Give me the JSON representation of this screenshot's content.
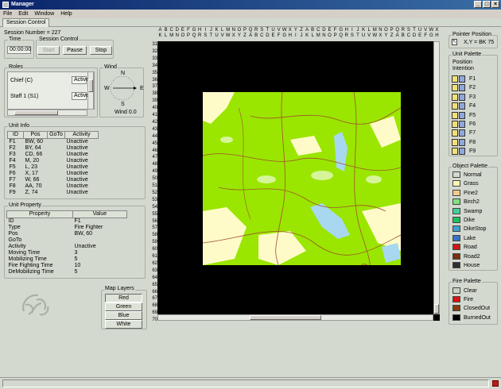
{
  "window": {
    "title": "Manager"
  },
  "menu": [
    "File",
    "Edit",
    "Window",
    "Help"
  ],
  "tabs": [
    {
      "label": "Session Control"
    }
  ],
  "session": {
    "number_label": "Session Number = 227"
  },
  "time": {
    "title": "Time",
    "value": "00:00:00"
  },
  "session_control": {
    "title": "Session Control",
    "buttons": [
      "Start",
      "Pause",
      "Stop"
    ]
  },
  "roles": {
    "title": "Roles",
    "items": [
      {
        "name": "Chief  (C)",
        "status": "Active"
      },
      {
        "name": "Staff 1  (S1)",
        "status": "Active"
      }
    ]
  },
  "wind": {
    "title": "Wind",
    "N": "N",
    "S": "S",
    "E": "E",
    "W": "W",
    "value": "Wind 0.0"
  },
  "unit_info": {
    "title": "Unit Info",
    "columns": [
      "ID",
      "Pos",
      "GoTo",
      "Activity"
    ],
    "rows": [
      [
        "F1",
        "BW, 60",
        "",
        "Unactive"
      ],
      [
        "F2",
        "BY, 64",
        "",
        "Unactive"
      ],
      [
        "F3",
        "CD, 66",
        "",
        "Unactive"
      ],
      [
        "F4",
        "M, 20",
        "",
        "Unactive"
      ],
      [
        "F5",
        "L, 23",
        "",
        "Unactive"
      ],
      [
        "F6",
        "X, 17",
        "",
        "Unactive"
      ],
      [
        "F7",
        "W, 66",
        "",
        "Unactive"
      ],
      [
        "F8",
        "AA, 70",
        "",
        "Unactive"
      ],
      [
        "F9",
        "Z, 74",
        "",
        "Unactive"
      ]
    ]
  },
  "unit_property": {
    "title": "Unit Property",
    "columns": [
      "Property",
      "Value"
    ],
    "rows": [
      [
        "ID",
        "F1"
      ],
      [
        "Type",
        "Fire Fighter"
      ],
      [
        "Pos",
        "BW, 60"
      ],
      [
        "GoTo",
        ""
      ],
      [
        "Activity",
        "Unactive"
      ],
      [
        "Moving Time",
        "3"
      ],
      [
        "Mobilizing Time",
        "5"
      ],
      [
        "Fire Fighting Time",
        "10"
      ],
      [
        "DeMobilizing Time",
        "5"
      ]
    ]
  },
  "map_layers": {
    "title": "Map Layers",
    "buttons": [
      "Red",
      "Green",
      "Blue",
      "White"
    ]
  },
  "grid": {
    "columns": [
      "A K",
      "B L",
      "C M",
      "D N",
      "E O",
      "F P",
      "G Q",
      "H R",
      "I S",
      "J T",
      "K U",
      "L V",
      "M W",
      "N X",
      "O Y",
      "P Z",
      "Q A",
      "R B",
      "S C",
      "T D",
      "U E",
      "V F",
      "W G",
      "X H",
      "Y I",
      "Z J",
      "A K",
      "B L",
      "C M",
      "D N",
      "E O",
      "F P",
      "G Q",
      "H R",
      "I S",
      "J T",
      "K U",
      "L V",
      "M W",
      "N X",
      "O Y",
      "P Z",
      "Q A",
      "R B",
      "S C",
      "T D",
      "U E",
      "V F",
      "W G",
      "X H"
    ],
    "rows": [
      "31",
      "32",
      "33",
      "34",
      "35",
      "36",
      "37",
      "38",
      "39",
      "40",
      "41",
      "42",
      "43",
      "44",
      "45",
      "46",
      "47",
      "48",
      "49",
      "50",
      "51",
      "52",
      "53",
      "54",
      "55",
      "56",
      "57",
      "58",
      "59",
      "60",
      "61",
      "62",
      "63",
      "64",
      "65",
      "66",
      "67",
      "68",
      "69",
      "70"
    ]
  },
  "pointer_position": {
    "title": "Pointer Position",
    "value": "X,Y = BK 75"
  },
  "unit_palette": {
    "title": "Unit Palette",
    "header": "Position\nIntention",
    "items": [
      "F1",
      "F2",
      "F3",
      "F4",
      "F5",
      "F6",
      "F7",
      "F8",
      "F9"
    ]
  },
  "object_palette": {
    "title": "Object Palette",
    "items": [
      {
        "label": "Normal",
        "color": "#d4d9cf"
      },
      {
        "label": "Grass",
        "color": "#fdf6b0"
      },
      {
        "label": "Pine2",
        "color": "#f5c98a"
      },
      {
        "label": "Birch2",
        "color": "#7fe07f"
      },
      {
        "label": "Swamp",
        "color": "#44d094"
      },
      {
        "label": "Dike",
        "color": "#20c060"
      },
      {
        "label": "DikeStop",
        "color": "#40a0d0"
      },
      {
        "label": "Lake",
        "color": "#3a70c8"
      },
      {
        "label": "Road",
        "color": "#d01818"
      },
      {
        "label": "Road2",
        "color": "#7a3010"
      },
      {
        "label": "House",
        "color": "#303030"
      }
    ]
  },
  "fire_palette": {
    "title": "Fire Palette",
    "items": [
      {
        "label": "Clear",
        "color": "#c8d0c0"
      },
      {
        "label": "Fire",
        "color": "#e01010"
      },
      {
        "label": "ClosedOut",
        "color": "#8a3a10"
      },
      {
        "label": "BurnedOut",
        "color": "#000000"
      }
    ]
  },
  "colors": {
    "map_green": "#9ae600",
    "map_cream": "#fffbc8",
    "map_water": "#a8d8f0",
    "map_road": "#a0522d"
  }
}
